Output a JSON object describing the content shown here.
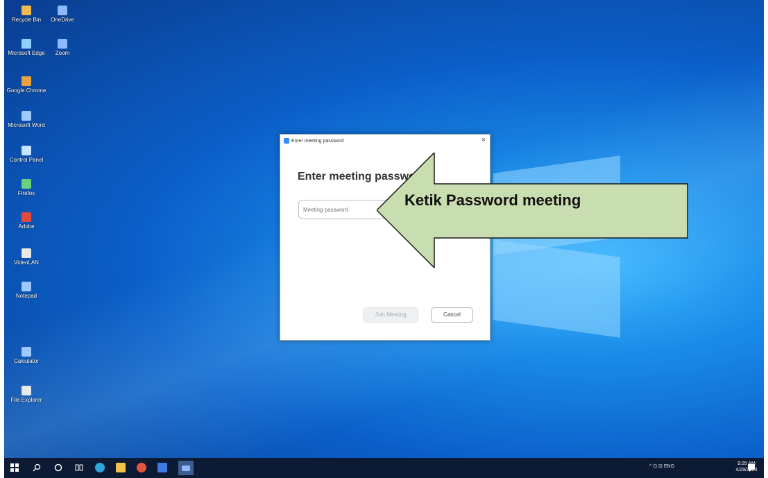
{
  "desktop": {
    "icons": [
      {
        "label": "Recycle Bin",
        "color": "#f2b84b"
      },
      {
        "label": "OneDrive",
        "color": "#8fb8ff"
      },
      {
        "label": "Microsoft Edge",
        "color": "#8fd0ff"
      },
      {
        "label": "Zoom",
        "color": "#8fb8ff"
      },
      {
        "label": "Google Chrome",
        "color": "#e8a33d"
      },
      {
        "label": "Microsoft Word",
        "color": "#9ec9ff"
      },
      {
        "label": "Control Panel",
        "color": "#c7e3ff"
      },
      {
        "label": "Firefox",
        "color": "#6ad27a"
      },
      {
        "label": "Adobe",
        "color": "#e24b3b"
      },
      {
        "label": "VideoLAN",
        "color": "#e8e8e8"
      },
      {
        "label": "Notepad",
        "color": "#9ec9ff"
      },
      {
        "label": "Calculator",
        "color": "#9ec9ff"
      },
      {
        "label": "File Explorer",
        "color": "#e8e8e8"
      }
    ]
  },
  "dialog": {
    "window_title": "Enter meeting password",
    "close_glyph": "×",
    "heading": "Enter meeting password",
    "password_placeholder": "Meeting password",
    "join_label": "Join Meeting",
    "cancel_label": "Cancel"
  },
  "annotation": {
    "text": "Ketik Password meeting",
    "fill": "#c9deb0",
    "stroke": "#1b1b1b"
  },
  "taskbar": {
    "start_icon": "windows-icon",
    "search_icon": "search-icon",
    "cortana_icon": "circle-icon",
    "taskview_icon": "task-view-icon",
    "tray_text": "^ ⊡ ⊟ ENG",
    "time": "9:25 AM",
    "date": "4/29/2020",
    "notification_icon": "notification-icon"
  }
}
